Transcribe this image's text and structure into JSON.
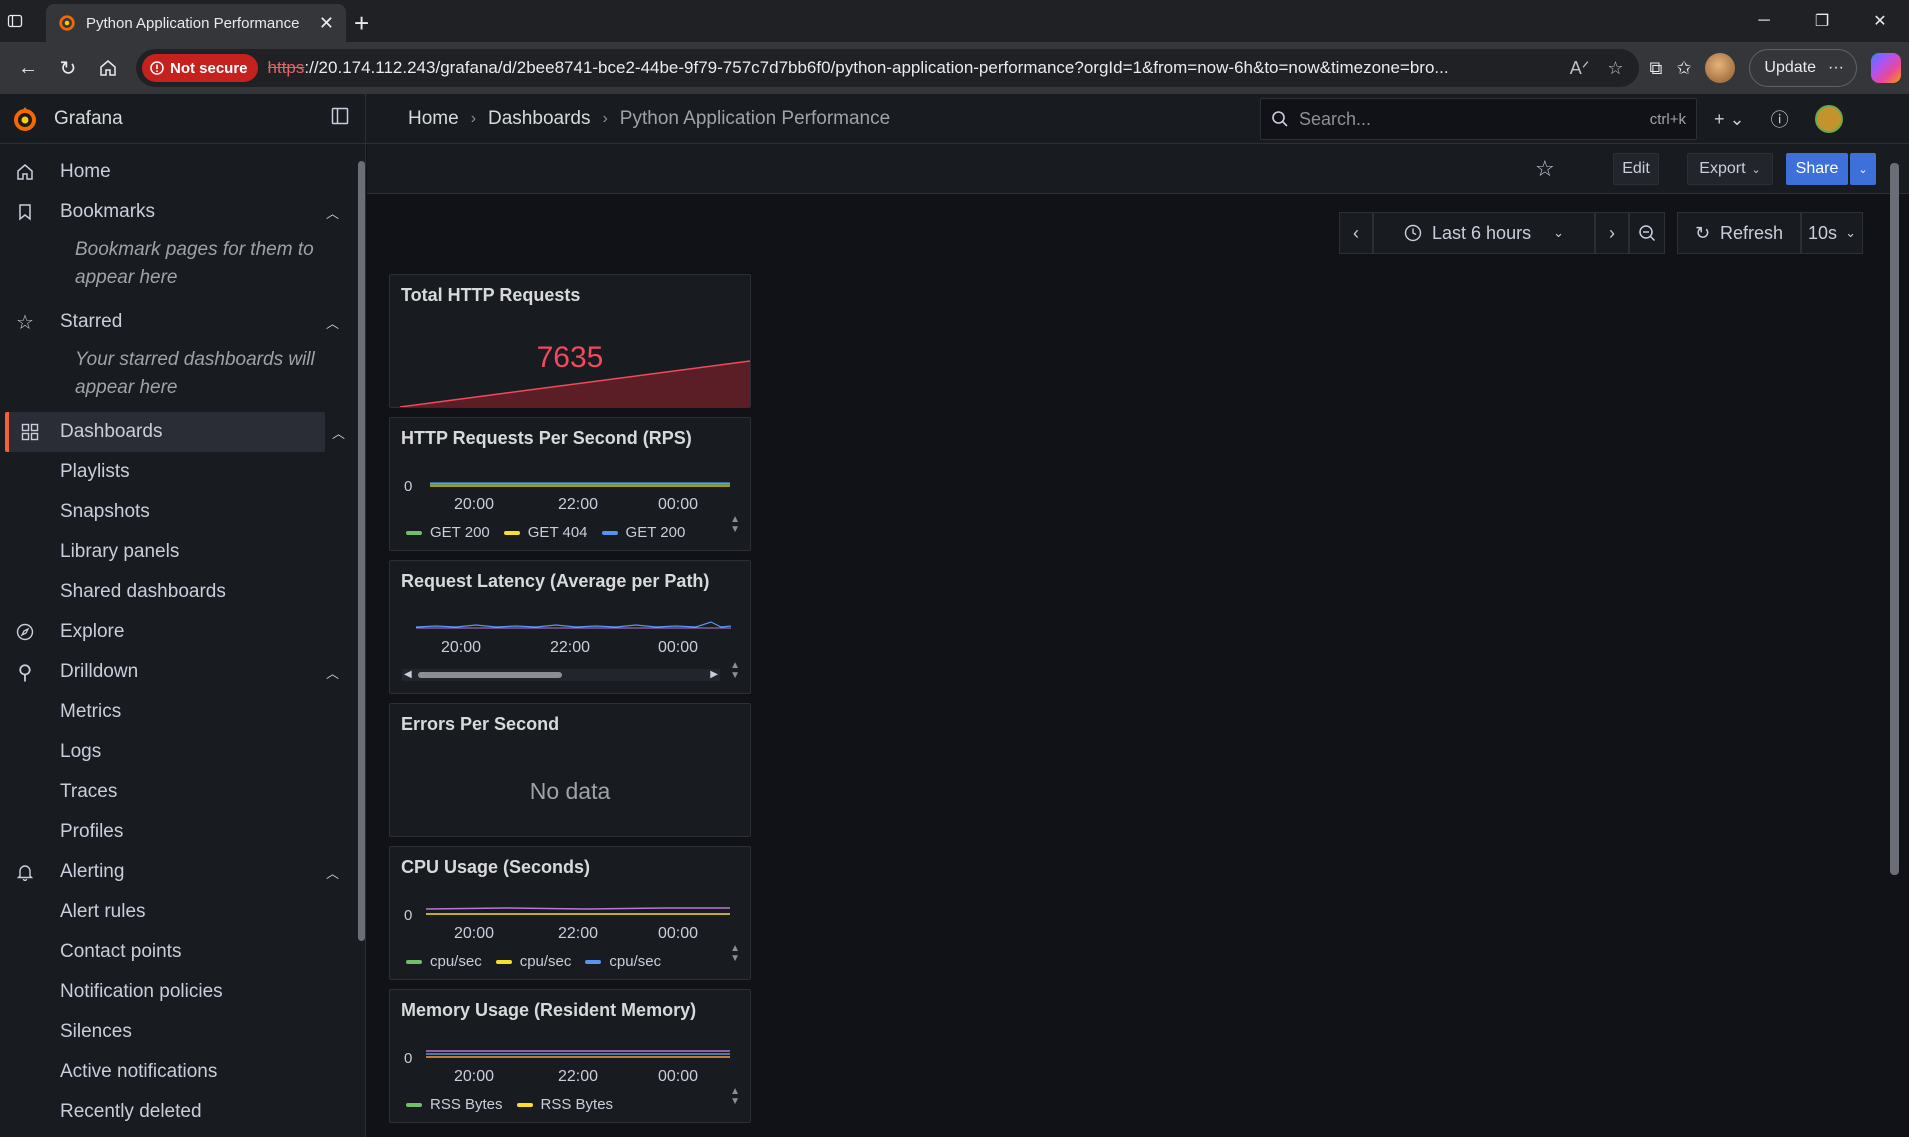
{
  "browser": {
    "tab_title": "Python Application Performance",
    "security_label": "Not secure",
    "url_scheme": "https",
    "url_rest": "://20.174.112.243/grafana/d/2bee8741-bce2-44be-9f79-757c7d7bb6f0/python-application-performance?orgId=1&from=now-6h&to=now&timezone=bro...",
    "update_label": "Update"
  },
  "grafana": {
    "brand": "Grafana",
    "breadcrumb": [
      "Home",
      "Dashboards",
      "Python Application Performance"
    ],
    "search_placeholder": "Search...",
    "search_shortcut": "ctrl+k"
  },
  "sidebar": {
    "home": "Home",
    "bookmarks": "Bookmarks",
    "bookmarks_note": "Bookmark pages for them to appear here",
    "starred": "Starred",
    "starred_note": "Your starred dashboards will appear here",
    "dashboards": "Dashboards",
    "dashboards_children": [
      "Playlists",
      "Snapshots",
      "Library panels",
      "Shared dashboards"
    ],
    "explore": "Explore",
    "drilldown": "Drilldown",
    "drilldown_children": [
      "Metrics",
      "Logs",
      "Traces",
      "Profiles"
    ],
    "alerting": "Alerting",
    "alerting_children": [
      "Alert rules",
      "Contact points",
      "Notification policies",
      "Silences",
      "Active notifications",
      "Recently deleted"
    ]
  },
  "toolbar": {
    "edit": "Edit",
    "export": "Export",
    "share": "Share",
    "time_range": "Last 6 hours",
    "refresh": "Refresh",
    "refresh_interval": "10s"
  },
  "panels": {
    "total_requests": {
      "title": "Total HTTP Requests",
      "value": "7635",
      "color": "#f2495c"
    },
    "rps": {
      "title": "HTTP Requests Per Second (RPS)",
      "zero": "0",
      "ticks": [
        "20:00",
        "22:00",
        "00:00"
      ],
      "legend": [
        "GET 200",
        "GET 404",
        "GET 200"
      ]
    },
    "latency": {
      "title": "Request Latency (Average per Path)",
      "ticks": [
        "20:00",
        "22:00",
        "00:00"
      ]
    },
    "errors": {
      "title": "Errors Per Second",
      "nodata": "No data"
    },
    "cpu": {
      "title": "CPU Usage (Seconds)",
      "zero": "0",
      "ticks": [
        "20:00",
        "22:00",
        "00:00"
      ],
      "legend": [
        "cpu/sec",
        "cpu/sec",
        "cpu/sec"
      ]
    },
    "memory": {
      "title": "Memory Usage (Resident Memory)",
      "zero": "0",
      "ticks": [
        "20:00",
        "22:00",
        "00:00"
      ],
      "legend": [
        "RSS Bytes",
        "RSS Bytes"
      ]
    }
  },
  "colors": {
    "accent": "#f55f3e",
    "series_green": "#73bf69",
    "series_yellow": "#fade2a",
    "series_blue": "#5794f2",
    "series_purple": "#b877d9",
    "series_orange": "#ff9830"
  }
}
